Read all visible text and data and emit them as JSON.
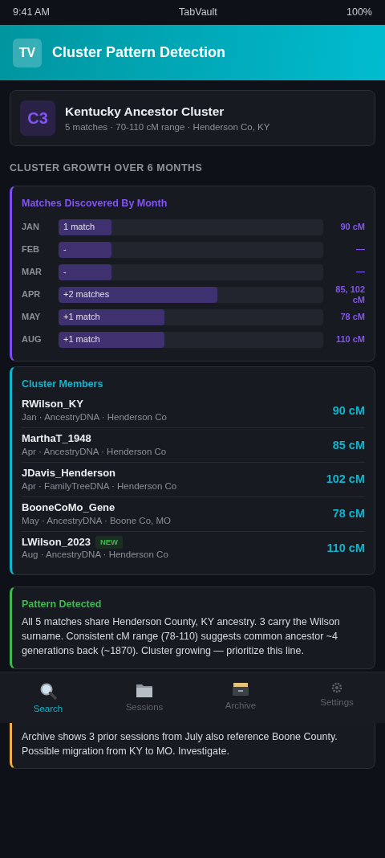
{
  "status_bar": {
    "time": "9:41 AM",
    "app": "TabVault",
    "battery": "100%"
  },
  "header": {
    "logo": "TV",
    "title": "Cluster Pattern Detection"
  },
  "cluster": {
    "badge": "C3",
    "name": "Kentucky Ancestor Cluster",
    "summary": "5 matches · 70-110 cM range · Henderson Co, KY"
  },
  "section_title": "CLUSTER GROWTH OVER 6 MONTHS",
  "growth": {
    "title": "Matches Discovered By Month",
    "months": [
      {
        "month": "JAN",
        "label": "1 match",
        "level": 0.2,
        "reading": "90 cM"
      },
      {
        "month": "FEB",
        "label": "-",
        "level": 0.2,
        "reading": "—"
      },
      {
        "month": "MAR",
        "label": "-",
        "level": 0.2,
        "reading": "—"
      },
      {
        "month": "APR",
        "label": "+2 matches",
        "level": 0.6,
        "reading": "85, 102 cM"
      },
      {
        "month": "MAY",
        "label": "+1 match",
        "level": 0.4,
        "reading": "78 cM"
      },
      {
        "month": "AUG",
        "label": "+1 match",
        "level": 0.4,
        "reading": "110 cM"
      }
    ]
  },
  "members": {
    "title": "Cluster Members",
    "items": [
      {
        "name": "RWilson_KY",
        "details": "Jan · AncestryDNA · Henderson Co",
        "cm": "90 cM",
        "new": false
      },
      {
        "name": "MarthaT_1948",
        "details": "Apr · AncestryDNA · Henderson Co",
        "cm": "85 cM",
        "new": false
      },
      {
        "name": "JDavis_Henderson",
        "details": "Apr · FamilyTreeDNA · Henderson Co",
        "cm": "102 cM",
        "new": false
      },
      {
        "name": "BooneCoMo_Gene",
        "details": "May · AncestryDNA · Boone Co, MO",
        "cm": "78 cM",
        "new": false
      },
      {
        "name": "LWilson_2023",
        "details": "Aug · AncestryDNA · Henderson Co",
        "cm": "110 cM",
        "new": true,
        "new_label": "NEW"
      }
    ]
  },
  "pattern": {
    "title": "Pattern Detected",
    "text": "All 5 matches share Henderson County, KY ancestry. 3 carry the Wilson surname. Consistent cM range (78-110) suggests common ancestor ~4 generations back (~1870). Cluster growing — prioritize this line."
  },
  "warning": {
    "text": "Archive shows 3 prior sessions from July also reference Boone County. Possible migration from KY to MO. Investigate."
  },
  "nav": [
    {
      "label": "Search",
      "selected": true
    },
    {
      "label": "Sessions",
      "selected": false
    },
    {
      "label": "Archive",
      "selected": false
    },
    {
      "label": "Settings",
      "selected": false
    }
  ]
}
